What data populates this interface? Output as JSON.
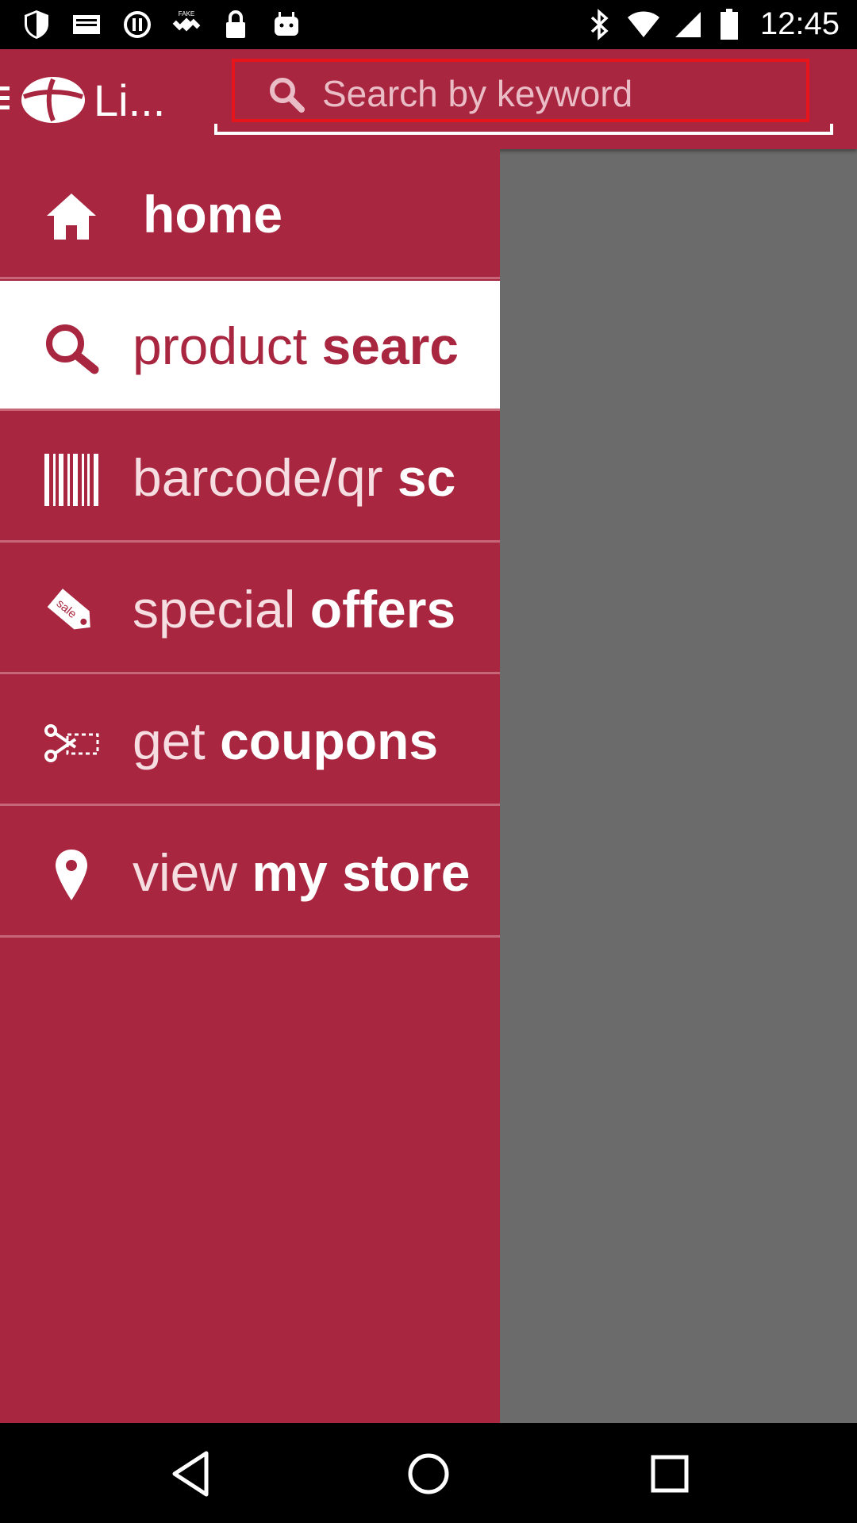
{
  "status_bar": {
    "time": "12:45",
    "icons": [
      "shield-icon",
      "mail-icon",
      "sync-icon",
      "satellite-icon",
      "lock-icon",
      "android-icon",
      "bluetooth-icon",
      "wifi-icon",
      "signal-icon",
      "battery-icon"
    ]
  },
  "app_bar": {
    "title": "Li...",
    "search_placeholder": "Search by keyword"
  },
  "drawer": {
    "items": [
      {
        "id": "home",
        "light": "",
        "bold": "home",
        "icon": "home-icon"
      },
      {
        "id": "product-search",
        "light": "product ",
        "bold": "searc",
        "icon": "search-icon",
        "active": true
      },
      {
        "id": "barcode",
        "light": "barcode/qr ",
        "bold": "sc",
        "icon": "barcode-icon"
      },
      {
        "id": "special-offers",
        "light": "special ",
        "bold": "offers",
        "icon": "sale-tag-icon"
      },
      {
        "id": "coupons",
        "light": "get ",
        "bold": "coupons",
        "icon": "scissors-icon"
      },
      {
        "id": "my-store",
        "light": "view ",
        "bold": "my store",
        "icon": "location-pin-icon"
      }
    ]
  },
  "colors": {
    "brand": "#a8263f",
    "overlay": "#6b6b6b",
    "highlight_border": "#e8141c"
  }
}
